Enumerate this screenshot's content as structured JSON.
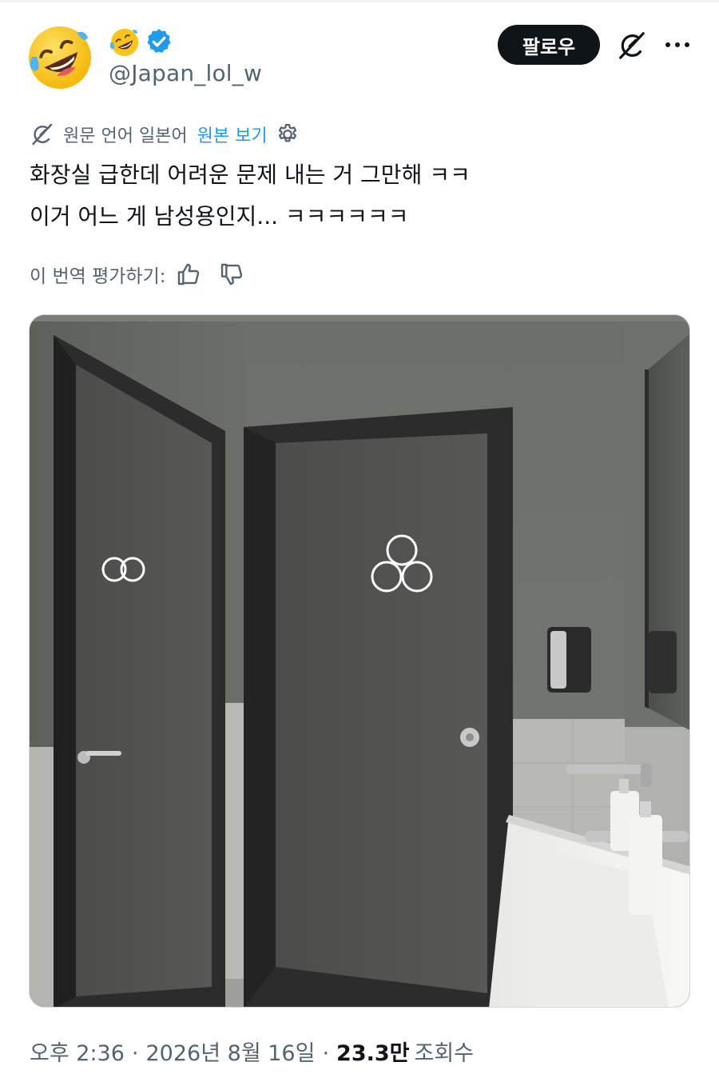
{
  "header": {
    "handle": "@Japan_lol_w",
    "follow_label": "팔로우",
    "avatar_icon": "rolling-laughing-emoji",
    "verified_color": "#1d9bf0"
  },
  "translation": {
    "source_text": "원문 언어 일본어",
    "view_original": "원본 보기",
    "link_color": "#1d9bf0"
  },
  "tweet": {
    "lines": [
      "화장실 급한데 어려운 문제 내는 거 그만해 ㅋㅋ",
      "이거 어느 게 남성용인지... ㅋㅋㅋㅋㅋㅋ"
    ]
  },
  "rating": {
    "label": "이 번역 평가하기:"
  },
  "meta": {
    "time": "오후 2:36",
    "date": "2026년 8월 16일",
    "views_count": "23.3만",
    "views_label": "조회수"
  }
}
